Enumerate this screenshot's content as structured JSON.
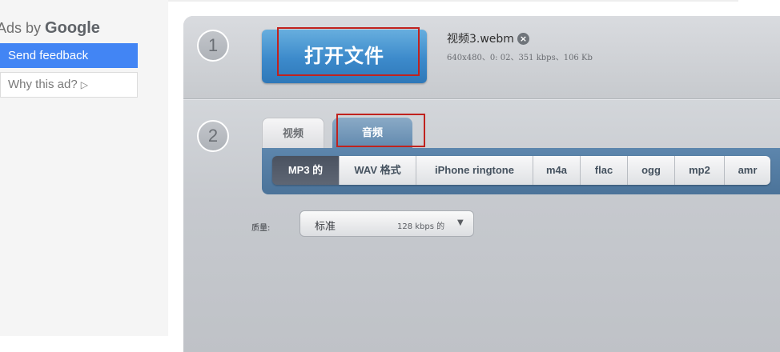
{
  "ads": {
    "ads_by": "Ads by",
    "brand": "Google",
    "send_feedback": "Send feedback",
    "why_this_ad": "Why this ad?"
  },
  "step1": {
    "number": "1",
    "open_button": "打开文件",
    "file_name": "视频3.webm",
    "file_meta": "640x480、0: 02、351 kbps、106 Kb"
  },
  "step2": {
    "number": "2",
    "tabs": [
      {
        "label": "视频"
      },
      {
        "label": "音频"
      }
    ],
    "formats": [
      {
        "label": "MP3 的"
      },
      {
        "label": "WAV 格式"
      },
      {
        "label": "iPhone ringtone"
      },
      {
        "label": "m4a"
      },
      {
        "label": "flac"
      },
      {
        "label": "ogg"
      },
      {
        "label": "mp2"
      },
      {
        "label": "amr"
      }
    ],
    "quality_label": "质量:",
    "quality_value": "标准",
    "quality_rate": "128 kbps 的"
  },
  "colors": {
    "open_button": "#3c8acb",
    "format_bar": "#5d86ad",
    "highlight_box": "#c0221e",
    "feedback_blue": "#4285f4"
  }
}
